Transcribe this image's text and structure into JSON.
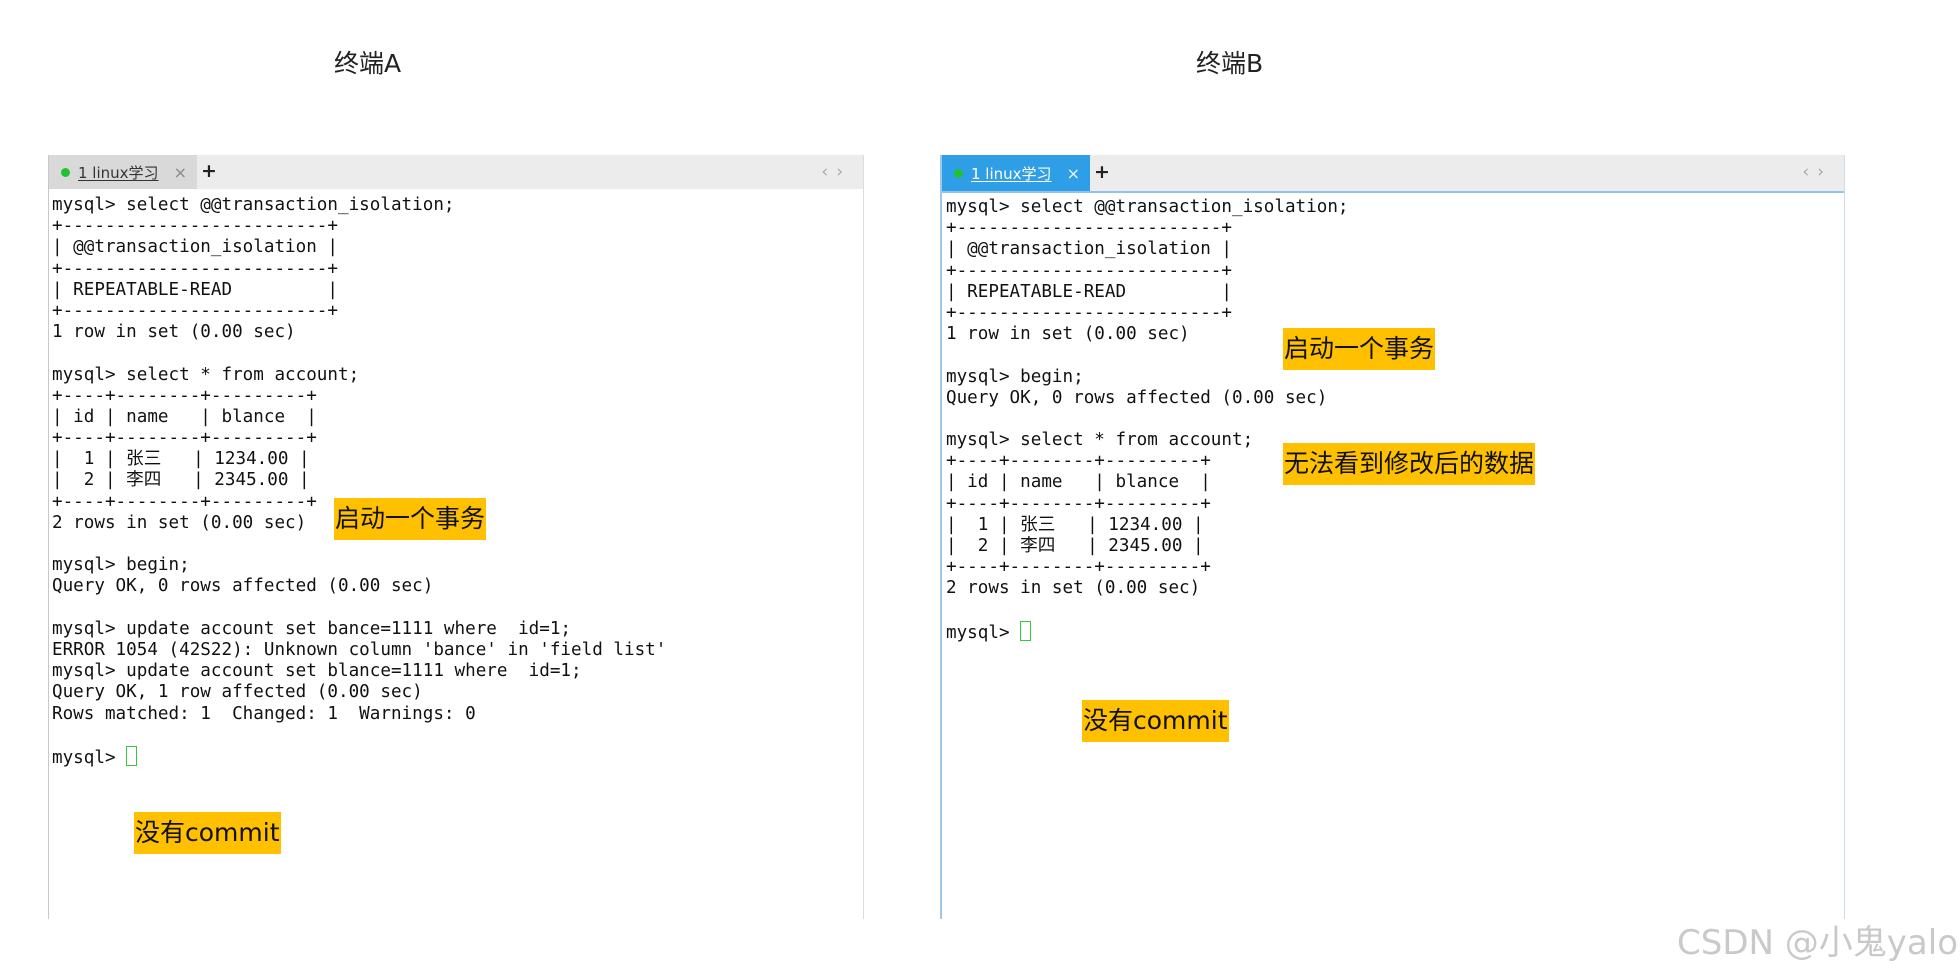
{
  "titles": {
    "a": "终端A",
    "b": "终端B"
  },
  "terminal_a": {
    "tab_label": "1 linux学习",
    "tab_close": "×",
    "new_tab": "+",
    "nav_prev": "‹",
    "nav_next": "›",
    "lines": [
      "mysql> select @@transaction_isolation;",
      "+-------------------------+",
      "| @@transaction_isolation |",
      "+-------------------------+",
      "| REPEATABLE-READ         |",
      "+-------------------------+",
      "1 row in set (0.00 sec)",
      "",
      "mysql> select * from account;",
      "+----+--------+---------+",
      "| id | name   | blance  |",
      "+----+--------+---------+",
      "|  1 | 张三   | 1234.00 |",
      "|  2 | 李四   | 2345.00 |",
      "+----+--------+---------+",
      "2 rows in set (0.00 sec)",
      "",
      "mysql> begin;",
      "Query OK, 0 rows affected (0.00 sec)",
      "",
      "mysql> update account set bance=1111 where  id=1;",
      "ERROR 1054 (42S22): Unknown column 'bance' in 'field list'",
      "mysql> update account set blance=1111 where  id=1;",
      "Query OK, 1 row affected (0.00 sec)",
      "Rows matched: 1  Changed: 1  Warnings: 0",
      ""
    ],
    "prompt": "mysql> "
  },
  "terminal_b": {
    "tab_label": "1 linux学习",
    "tab_close": "×",
    "new_tab": "+",
    "nav_prev": "‹",
    "nav_next": "›",
    "lines": [
      "mysql> select @@transaction_isolation;",
      "+-------------------------+",
      "| @@transaction_isolation |",
      "+-------------------------+",
      "| REPEATABLE-READ         |",
      "+-------------------------+",
      "1 row in set (0.00 sec)",
      "",
      "mysql> begin;",
      "Query OK, 0 rows affected (0.00 sec)",
      "",
      "mysql> select * from account;",
      "+----+--------+---------+",
      "| id | name   | blance  |",
      "+----+--------+---------+",
      "|  1 | 张三   | 1234.00 |",
      "|  2 | 李四   | 2345.00 |",
      "+----+--------+---------+",
      "2 rows in set (0.00 sec)",
      ""
    ],
    "prompt": "mysql> "
  },
  "notes": {
    "a_begin": "启动一个事务",
    "a_commit": "没有commit",
    "b_begin": "启动一个事务",
    "b_nodata": "无法看到修改后的数据",
    "b_commit": "没有commit"
  },
  "watermark": "CSDN @小鬼yalo",
  "colors": {
    "annotation_bg": "#ffc000",
    "active_tab": "#2e9ee6",
    "status_dot": "#21c230",
    "cursor": "#34c93e"
  }
}
